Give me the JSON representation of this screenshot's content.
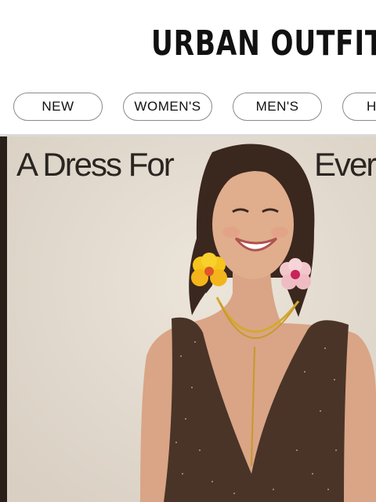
{
  "brand": {
    "name": "URBAN OUTFITTERS"
  },
  "nav": {
    "items": [
      {
        "label": "NEW"
      },
      {
        "label": "WOMEN'S"
      },
      {
        "label": "MEN'S"
      },
      {
        "label": "HOME"
      }
    ]
  },
  "hero": {
    "headline_left": "A Dress For",
    "headline_right": "Every",
    "image_icon": "model-photo"
  },
  "colors": {
    "nav_border": "#8a8a8a",
    "text": "#111111",
    "hero_background": "#e2d9ce"
  }
}
